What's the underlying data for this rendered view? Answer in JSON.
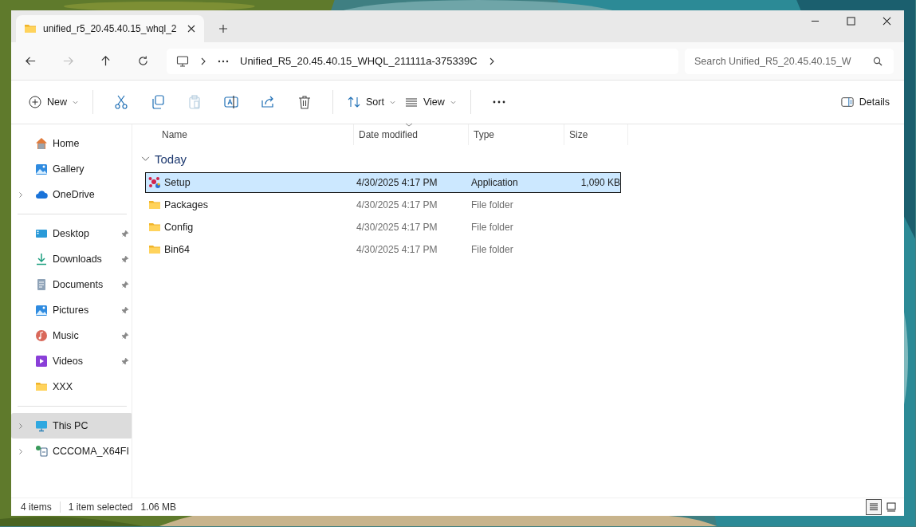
{
  "window": {
    "tab": {
      "title": "unified_r5_20.45.40.15_whql_2",
      "selected": true
    }
  },
  "navigation": {
    "back_disabled": false,
    "forward_disabled": true
  },
  "address_bar": {
    "path": "Unified_R5_20.45.40.15_WHQL_211111a-375339C"
  },
  "search": {
    "placeholder": "Search Unified_R5_20.45.40.15_W"
  },
  "toolbar": {
    "new_label": "New",
    "tools": [
      {
        "kind": "cut",
        "disabled": false
      },
      {
        "kind": "copy",
        "disabled": false
      },
      {
        "kind": "paste",
        "disabled": true
      },
      {
        "kind": "rename",
        "disabled": false
      },
      {
        "kind": "share",
        "disabled": false
      },
      {
        "kind": "delete",
        "disabled": false
      }
    ],
    "sort_label": "Sort",
    "view_label": "View",
    "details_label": "Details"
  },
  "sidebar": {
    "sections": [
      {
        "items": [
          {
            "label": "Home",
            "expandable": false,
            "pinned": false,
            "selected": false
          },
          {
            "label": "Gallery",
            "expandable": false,
            "pinned": false,
            "selected": false
          },
          {
            "label": "OneDrive",
            "expandable": true,
            "pinned": false,
            "selected": false
          }
        ]
      },
      {
        "items": [
          {
            "label": "Desktop",
            "expandable": false,
            "pinned": true,
            "selected": false
          },
          {
            "label": "Downloads",
            "expandable": false,
            "pinned": true,
            "selected": false
          },
          {
            "label": "Documents",
            "expandable": false,
            "pinned": true,
            "selected": false
          },
          {
            "label": "Pictures",
            "expandable": false,
            "pinned": true,
            "selected": false
          },
          {
            "label": "Music",
            "expandable": false,
            "pinned": true,
            "selected": false
          },
          {
            "label": "Videos",
            "expandable": false,
            "pinned": true,
            "selected": false
          },
          {
            "label": "XXX",
            "expandable": false,
            "pinned": false,
            "selected": false
          }
        ]
      },
      {
        "items": [
          {
            "label": "This PC",
            "expandable": true,
            "pinned": false,
            "selected": true
          },
          {
            "label": "CCCOMA_X64FI",
            "expandable": true,
            "pinned": false,
            "selected": false
          }
        ]
      }
    ]
  },
  "table": {
    "columns": [
      {
        "label": "Name",
        "sorted": false
      },
      {
        "label": "Date modified",
        "sorted": true
      },
      {
        "label": "Type",
        "sorted": false
      },
      {
        "label": "Size",
        "sorted": false
      }
    ],
    "groups": [
      {
        "label": "Today",
        "expanded": true,
        "rows": [
          {
            "kind": "app",
            "name": "Setup",
            "date": "4/30/2025 4:17 PM",
            "type": "Application",
            "size": "1,090 KB",
            "selected": true
          },
          {
            "kind": "folder",
            "name": "Packages",
            "date": "4/30/2025 4:17 PM",
            "type": "File folder",
            "selected": false
          },
          {
            "kind": "folder",
            "name": "Config",
            "date": "4/30/2025 4:17 PM",
            "type": "File folder",
            "selected": false
          },
          {
            "kind": "folder",
            "name": "Bin64",
            "date": "4/30/2025 4:17 PM",
            "type": "File folder",
            "selected": false
          }
        ]
      }
    ]
  },
  "status_bar": {
    "item_count": "4 items",
    "selection": "1 item selected",
    "selection_size": "1.06 MB",
    "views": [
      {
        "kind": "details",
        "selected": true
      },
      {
        "kind": "tiles",
        "selected": false
      }
    ]
  }
}
